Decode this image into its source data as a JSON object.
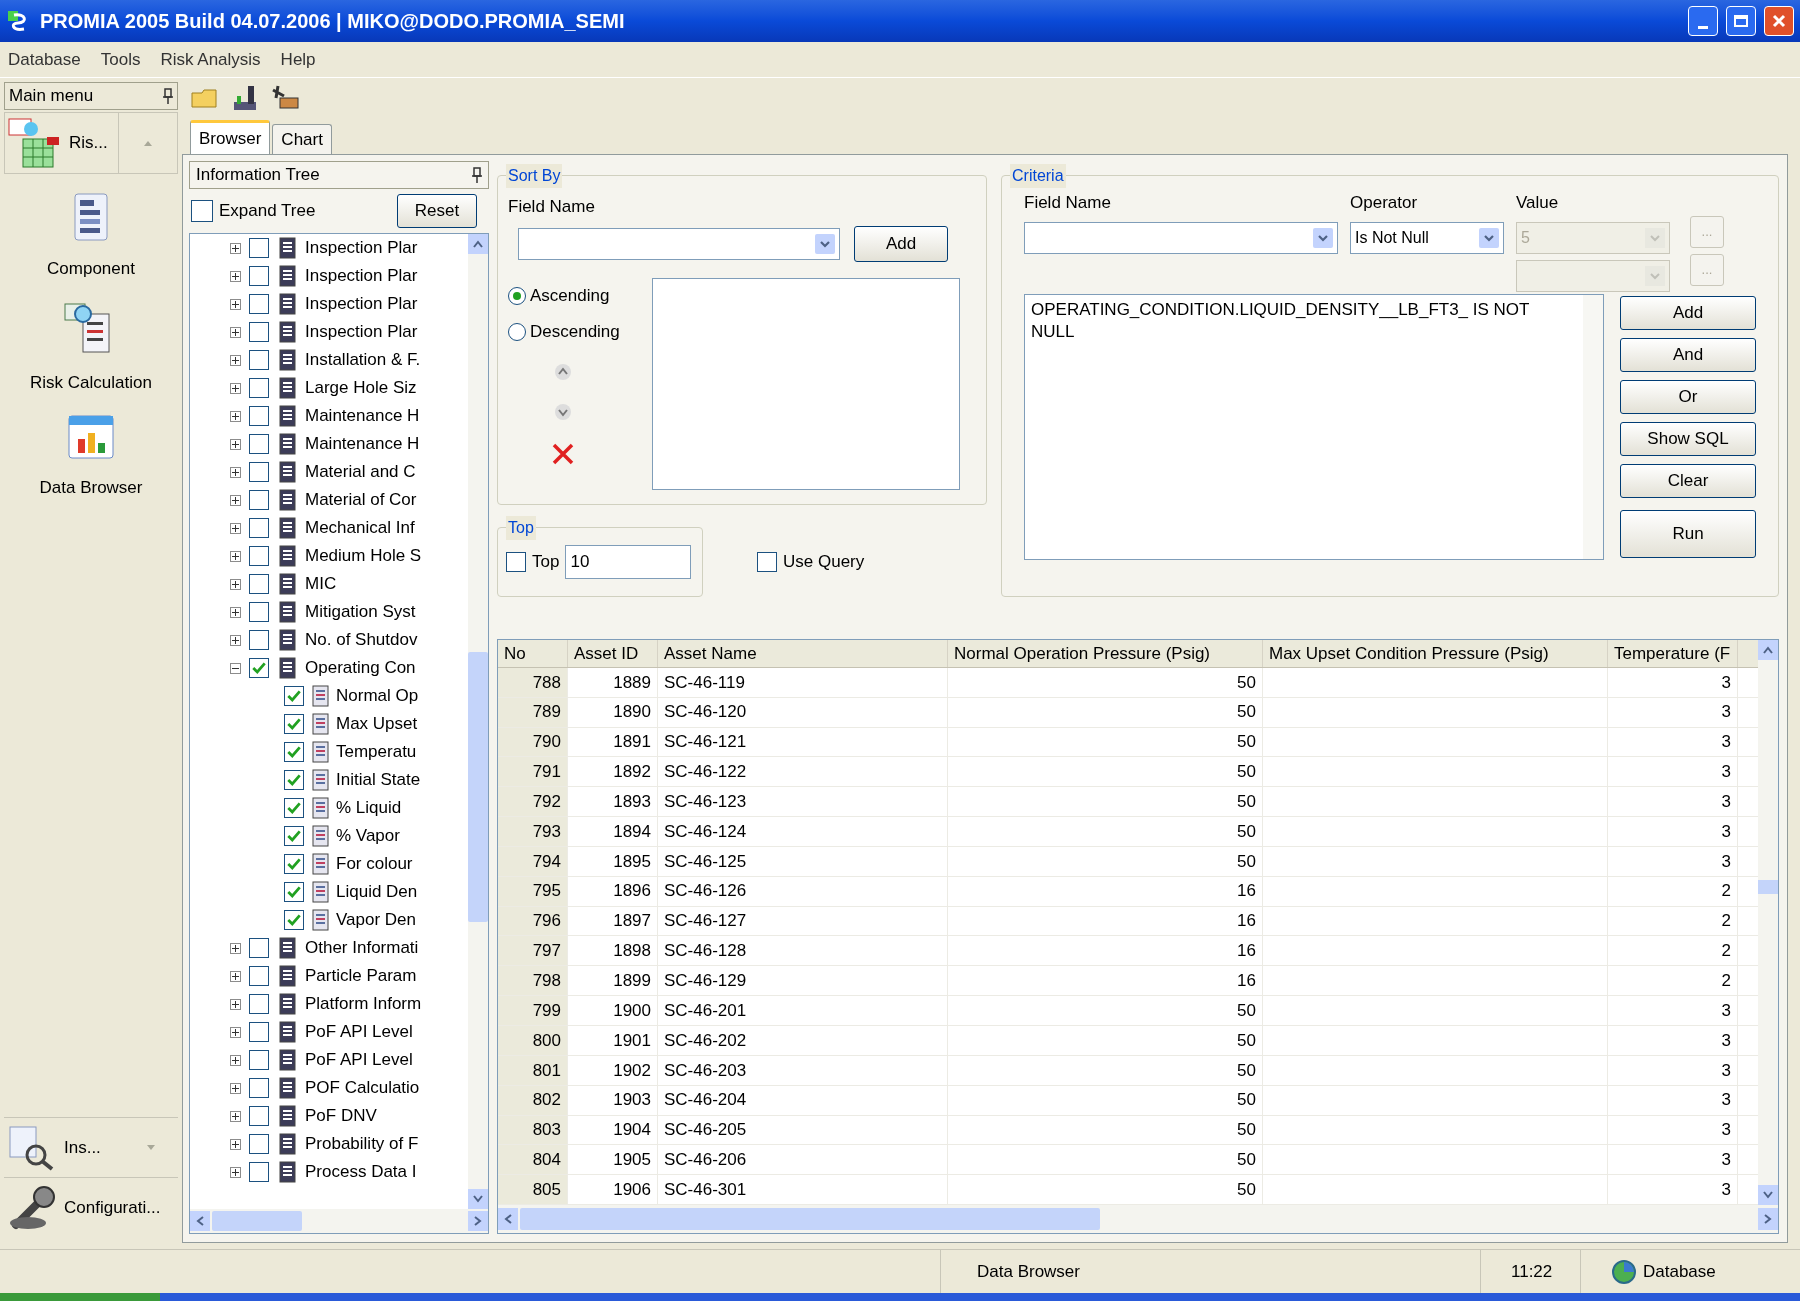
{
  "window": {
    "title": "PROMIA 2005 Build 04.07.2006 | MIKO@DODO.PROMIA_SEMI"
  },
  "menu": [
    "Database",
    "Tools",
    "Risk Analysis",
    "Help"
  ],
  "sidebar": {
    "header": "Main menu",
    "top_button": "Ris...",
    "items": [
      "Component",
      "Risk Calculation",
      "Data Browser"
    ],
    "bottom_buttons": [
      "Ins...",
      "Configurati..."
    ]
  },
  "tabs": [
    {
      "label": "Browser",
      "selected": true
    },
    {
      "label": "Chart",
      "selected": false
    }
  ],
  "tree": {
    "header": "Information Tree",
    "expand_tree": {
      "label": "Expand Tree",
      "checked": false
    },
    "reset": "Reset",
    "items": [
      {
        "label": "Inspection Plar",
        "checked": false,
        "expanded": false
      },
      {
        "label": "Inspection Plar",
        "checked": false,
        "expanded": false
      },
      {
        "label": "Inspection Plar",
        "checked": false,
        "expanded": false
      },
      {
        "label": "Inspection Plar",
        "checked": false,
        "expanded": false
      },
      {
        "label": "Installation & F.",
        "checked": false,
        "expanded": false
      },
      {
        "label": "Large Hole Siz",
        "checked": false,
        "expanded": false
      },
      {
        "label": "Maintenance H",
        "checked": false,
        "expanded": false
      },
      {
        "label": "Maintenance H",
        "checked": false,
        "expanded": false
      },
      {
        "label": "Material and C",
        "checked": false,
        "expanded": false
      },
      {
        "label": "Material of Cor",
        "checked": false,
        "expanded": false
      },
      {
        "label": "Mechanical Inf",
        "checked": false,
        "expanded": false
      },
      {
        "label": "Medium Hole S",
        "checked": false,
        "expanded": false
      },
      {
        "label": "MIC",
        "checked": false,
        "expanded": false
      },
      {
        "label": "Mitigation Syst",
        "checked": false,
        "expanded": false
      },
      {
        "label": "No. of Shutdov",
        "checked": false,
        "expanded": false
      },
      {
        "label": "Operating Con",
        "checked": true,
        "expanded": true,
        "children": [
          {
            "label": "Normal Op",
            "checked": true
          },
          {
            "label": "Max Upset",
            "checked": true
          },
          {
            "label": "Temperatu",
            "checked": true
          },
          {
            "label": "Initial State",
            "checked": true
          },
          {
            "label": "% Liquid",
            "checked": true
          },
          {
            "label": "% Vapor",
            "checked": true
          },
          {
            "label": "For colour",
            "checked": true
          },
          {
            "label": "Liquid Den",
            "checked": true
          },
          {
            "label": "Vapor Den",
            "checked": true
          }
        ]
      },
      {
        "label": "Other Informati",
        "checked": false,
        "expanded": false
      },
      {
        "label": "Particle Param",
        "checked": false,
        "expanded": false
      },
      {
        "label": "Platform Inform",
        "checked": false,
        "expanded": false
      },
      {
        "label": "PoF API Level",
        "checked": false,
        "expanded": false
      },
      {
        "label": "PoF API Level",
        "checked": false,
        "expanded": false
      },
      {
        "label": "POF Calculatio",
        "checked": false,
        "expanded": false
      },
      {
        "label": "PoF DNV",
        "checked": false,
        "expanded": false
      },
      {
        "label": "Probability of F",
        "checked": false,
        "expanded": false
      },
      {
        "label": "Process Data I",
        "checked": false,
        "expanded": false
      }
    ]
  },
  "sort_by": {
    "title": "Sort By",
    "field_label": "Field Name",
    "add": "Add",
    "order": [
      {
        "label": "Ascending",
        "selected": true
      },
      {
        "label": "Descending",
        "selected": false
      }
    ]
  },
  "top": {
    "title": "Top",
    "checkbox": {
      "label": "Top",
      "checked": false
    },
    "value": "10"
  },
  "use_query": {
    "label": "Use Query",
    "checked": false
  },
  "criteria": {
    "title": "Criteria",
    "field_label": "Field Name",
    "operator_label": "Operator",
    "operator": "Is Not Null",
    "value_label": "Value",
    "value": "5",
    "value_buttons": [
      "...",
      "..."
    ],
    "expression": "OPERATING_CONDITION.LIQUID_DENSITY__LB_FT3_ IS NOT NULL",
    "buttons": [
      "Add",
      "And",
      "Or",
      "Show SQL",
      "Clear",
      "Run"
    ]
  },
  "table": {
    "columns": [
      "No",
      "Asset ID",
      "Asset Name",
      "Normal Operation Pressure (Psig)",
      "Max Upset Condition Pressure (Psig)",
      "Temperature (F"
    ],
    "rows": [
      [
        "788",
        "1889",
        "SC-46-119",
        "50",
        "",
        "3"
      ],
      [
        "789",
        "1890",
        "SC-46-120",
        "50",
        "",
        "3"
      ],
      [
        "790",
        "1891",
        "SC-46-121",
        "50",
        "",
        "3"
      ],
      [
        "791",
        "1892",
        "SC-46-122",
        "50",
        "",
        "3"
      ],
      [
        "792",
        "1893",
        "SC-46-123",
        "50",
        "",
        "3"
      ],
      [
        "793",
        "1894",
        "SC-46-124",
        "50",
        "",
        "3"
      ],
      [
        "794",
        "1895",
        "SC-46-125",
        "50",
        "",
        "3"
      ],
      [
        "795",
        "1896",
        "SC-46-126",
        "16",
        "",
        "2"
      ],
      [
        "796",
        "1897",
        "SC-46-127",
        "16",
        "",
        "2"
      ],
      [
        "797",
        "1898",
        "SC-46-128",
        "16",
        "",
        "2"
      ],
      [
        "798",
        "1899",
        "SC-46-129",
        "16",
        "",
        "2"
      ],
      [
        "799",
        "1900",
        "SC-46-201",
        "50",
        "",
        "3"
      ],
      [
        "800",
        "1901",
        "SC-46-202",
        "50",
        "",
        "3"
      ],
      [
        "801",
        "1902",
        "SC-46-203",
        "50",
        "",
        "3"
      ],
      [
        "802",
        "1903",
        "SC-46-204",
        "50",
        "",
        "3"
      ],
      [
        "803",
        "1904",
        "SC-46-205",
        "50",
        "",
        "3"
      ],
      [
        "804",
        "1905",
        "SC-46-206",
        "50",
        "",
        "3"
      ],
      [
        "805",
        "1906",
        "SC-46-301",
        "50",
        "",
        "3"
      ]
    ]
  },
  "status_bar": {
    "view": "Data Browser",
    "time": "11:22",
    "mode": "Database"
  }
}
